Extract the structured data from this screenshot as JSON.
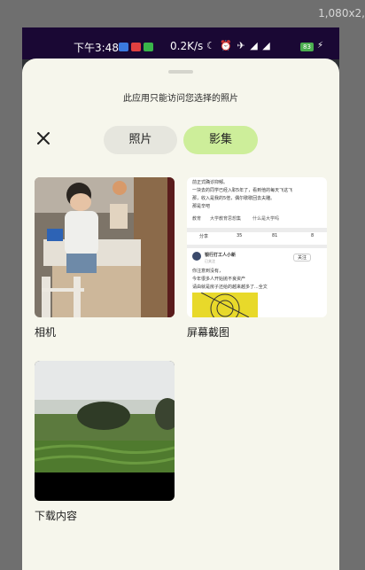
{
  "window": {
    "resolution_label": "1,080x2,"
  },
  "status_bar": {
    "time": "下午3:48",
    "net_speed": "0.2K/s",
    "icons": "☾ ⏰ ✈ ◢ ◢",
    "battery": "83"
  },
  "sheet": {
    "notice": "此应用只能访问您选择的照片",
    "tabs": [
      {
        "label": "照片",
        "selected": false
      },
      {
        "label": "影集",
        "selected": true
      }
    ]
  },
  "albums": [
    {
      "label": "相机"
    },
    {
      "label": "屏幕截图",
      "preview": {
        "post_lines": [
          "前正式确诊抑郁。",
          "一块去的同学已经入职5年了，看到他的每天飞这飞",
          "那，收入是我的5倍，偶尔歇歇回去夫雕。",
          "那是辛吧"
        ],
        "tags": [
          "教育",
          "大学教育思想集",
          "什么是大学吗"
        ],
        "actions": [
          "分享",
          "35",
          "81",
          "8"
        ],
        "author": "银行打工人小新",
        "author_sub": "已关注",
        "follow": "关注",
        "body_lines": [
          "你注意到没有，",
          "今年很多人开始抛不良资产",
          "请由就是房子还给的越来越多了...全文"
        ]
      }
    },
    {
      "label": "下载内容"
    }
  ],
  "colors": {
    "sheet_bg": "#f6f6ec",
    "selected_tab": "#cdee9a",
    "unselected_tab": "#e6e6de"
  }
}
